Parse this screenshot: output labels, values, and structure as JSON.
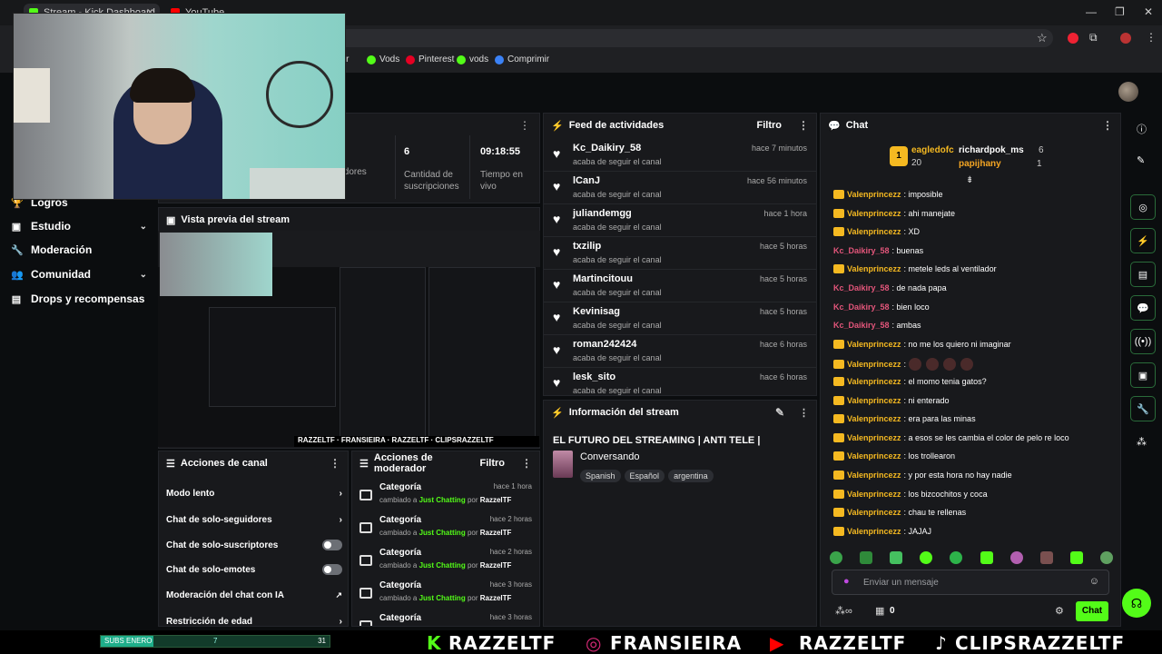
{
  "browser": {
    "tabs": [
      {
        "label": "Stream - Kick Dashboard",
        "color": "#53fc18"
      },
      {
        "label": "YouTube",
        "color": "#ff0000"
      }
    ],
    "bookmarks": [
      {
        "label": "tter",
        "color": "#888"
      },
      {
        "label": "Vods",
        "color": "#53fc18"
      },
      {
        "label": "Pinterest",
        "color": "#e60023"
      },
      {
        "label": "vods",
        "color": "#53fc18"
      },
      {
        "label": "Comprimir",
        "color": "#3b82f6"
      }
    ]
  },
  "sidebar": {
    "items": [
      {
        "label": "Logros",
        "icon": "trophy-icon"
      },
      {
        "label": "Estudio",
        "icon": "camera-icon",
        "expandable": true
      },
      {
        "label": "Moderación",
        "icon": "wrench-icon"
      },
      {
        "label": "Comunidad",
        "icon": "users-icon",
        "expandable": true
      },
      {
        "label": "Drops y recompensas",
        "icon": "gift-icon"
      }
    ]
  },
  "stats": {
    "followers_label": "uidores",
    "subs_value": "6",
    "subs_label": "Cantidad de suscripciones",
    "time_value": "09:18:55",
    "time_label": "Tiempo en vivo"
  },
  "preview": {
    "title": "Vista previa del stream"
  },
  "feed": {
    "title": "Feed de actividades",
    "filter": "Filtro",
    "items": [
      {
        "user": "Kc_Daikiry_58",
        "action": "acaba de seguir el canal",
        "time": "hace 7 minutos"
      },
      {
        "user": "lCanJ",
        "action": "acaba de seguir el canal",
        "time": "hace 56 minutos"
      },
      {
        "user": "juliandemgg",
        "action": "acaba de seguir el canal",
        "time": "hace 1 hora"
      },
      {
        "user": "txzilip",
        "action": "acaba de seguir el canal",
        "time": "hace 5 horas"
      },
      {
        "user": "Martincitouu",
        "action": "acaba de seguir el canal",
        "time": "hace 5 horas"
      },
      {
        "user": "Kevinisag",
        "action": "acaba de seguir el canal",
        "time": "hace 5 horas"
      },
      {
        "user": "roman242424",
        "action": "acaba de seguir el canal",
        "time": "hace 6 horas"
      },
      {
        "user": "lesk_sito",
        "action": "acaba de seguir el canal",
        "time": "hace 6 horas"
      }
    ]
  },
  "stream_info": {
    "title": "Información del stream",
    "stream_title": "EL FUTURO DEL STREAMING | ANTI TELE |",
    "category": "Conversando",
    "tags": [
      "Spanish",
      "Español",
      "argentina"
    ]
  },
  "channel_actions": {
    "title": "Acciones de canal",
    "items": [
      {
        "label": "Modo lento",
        "control": "chevron"
      },
      {
        "label": "Chat de solo-seguidores",
        "control": "chevron"
      },
      {
        "label": "Chat de solo-suscriptores",
        "control": "toggle"
      },
      {
        "label": "Chat de solo-emotes",
        "control": "toggle"
      },
      {
        "label": "Moderación del chat con IA",
        "control": "external"
      },
      {
        "label": "Restricción de edad",
        "control": "chevron"
      }
    ]
  },
  "mod_actions": {
    "title": "Acciones de moderador",
    "filter": "Filtro",
    "items": [
      {
        "category": "Categoría",
        "prefix": "cambiado a",
        "game": "Just Chatting",
        "by": "por",
        "user": "RazzelTF",
        "time": "hace 1 hora"
      },
      {
        "category": "Categoría",
        "prefix": "cambiado a",
        "game": "Just Chatting",
        "by": "por",
        "user": "RazzelTF",
        "time": "hace 2 horas"
      },
      {
        "category": "Categoría",
        "prefix": "cambiado a",
        "game": "Just Chatting",
        "by": "por",
        "user": "RazzelTF",
        "time": "hace 2 horas"
      },
      {
        "category": "Categoría",
        "prefix": "cambiado a",
        "game": "Just Chatting",
        "by": "por",
        "user": "RazzelTF",
        "time": "hace 3 horas"
      },
      {
        "category": "Categoría",
        "prefix": "",
        "game": "",
        "by": "",
        "user": "",
        "time": "hace 3 horas"
      }
    ]
  },
  "chat": {
    "title": "Chat",
    "leaderboard": {
      "first_name": "eagledofc",
      "first_count": "20",
      "second_name": "richardpok_ms",
      "second_count": "6",
      "third_name": "papijhany",
      "third_count": "1"
    },
    "messages": [
      {
        "user": "Valenprincezz",
        "text": ": imposible",
        "color": "#f5b921",
        "crown": true
      },
      {
        "user": "Valenprincezz",
        "text": ": ahi manejate",
        "color": "#f5b921",
        "crown": true
      },
      {
        "user": "Valenprincezz",
        "text": ": XD",
        "color": "#f5b921",
        "crown": true
      },
      {
        "user": "Kc_Daikiry_58",
        "text": ": buenas",
        "color": "#e2557a",
        "crown": false
      },
      {
        "user": "Valenprincezz",
        "text": ": metele leds al ventilador",
        "color": "#f5b921",
        "crown": true
      },
      {
        "user": "Kc_Daikiry_58",
        "text": ": de nada papa",
        "color": "#e2557a",
        "crown": false
      },
      {
        "user": "Kc_Daikiry_58",
        "text": ": bien loco",
        "color": "#e2557a",
        "crown": false
      },
      {
        "user": "Kc_Daikiry_58",
        "text": ": ambas",
        "color": "#e2557a",
        "crown": false
      },
      {
        "user": "Valenprincezz",
        "text": ": no me los quiero ni imaginar",
        "color": "#f5b921",
        "crown": true
      },
      {
        "user": "Valenprincezz",
        "text": ":",
        "color": "#f5b921",
        "crown": true,
        "emotes": 4
      },
      {
        "user": "Valenprincezz",
        "text": ": el momo tenia gatos?",
        "color": "#f5b921",
        "crown": true
      },
      {
        "user": "Valenprincezz",
        "text": ": ni enterado",
        "color": "#f5b921",
        "crown": true
      },
      {
        "user": "Valenprincezz",
        "text": ": era para las minas",
        "color": "#f5b921",
        "crown": true
      },
      {
        "user": "Valenprincezz",
        "text": ": a esos se les cambia el color de pelo re loco",
        "color": "#f5b921",
        "crown": true
      },
      {
        "user": "Valenprincezz",
        "text": ": los trollearon",
        "color": "#f5b921",
        "crown": true
      },
      {
        "user": "Valenprincezz",
        "text": ": y por esta hora no hay nadie",
        "color": "#f5b921",
        "crown": true
      },
      {
        "user": "Valenprincezz",
        "text": ": los bizcochitos y coca",
        "color": "#f5b921",
        "crown": true
      },
      {
        "user": "Valenprincezz",
        "text": ": chau te rellenas",
        "color": "#f5b921",
        "crown": true
      },
      {
        "user": "Valenprincezz",
        "text": ": JAJAJ",
        "color": "#f5b921",
        "crown": true
      }
    ],
    "input_placeholder": "Enviar un mensaje",
    "points": "0",
    "send_label": "Chat"
  },
  "overlay": {
    "subs_label": "SUBS ENERO",
    "subs_current": "7",
    "subs_goal": "31",
    "subs_progress": 0.23,
    "brands": [
      "RAZZELTF",
      "FRANSIEIRA",
      "RAZZELTF",
      "CLIPSRAZZELTF"
    ]
  },
  "colors": {
    "accent": "#53fc18",
    "crown": "#f5b921",
    "background": "#0b0d0f"
  }
}
